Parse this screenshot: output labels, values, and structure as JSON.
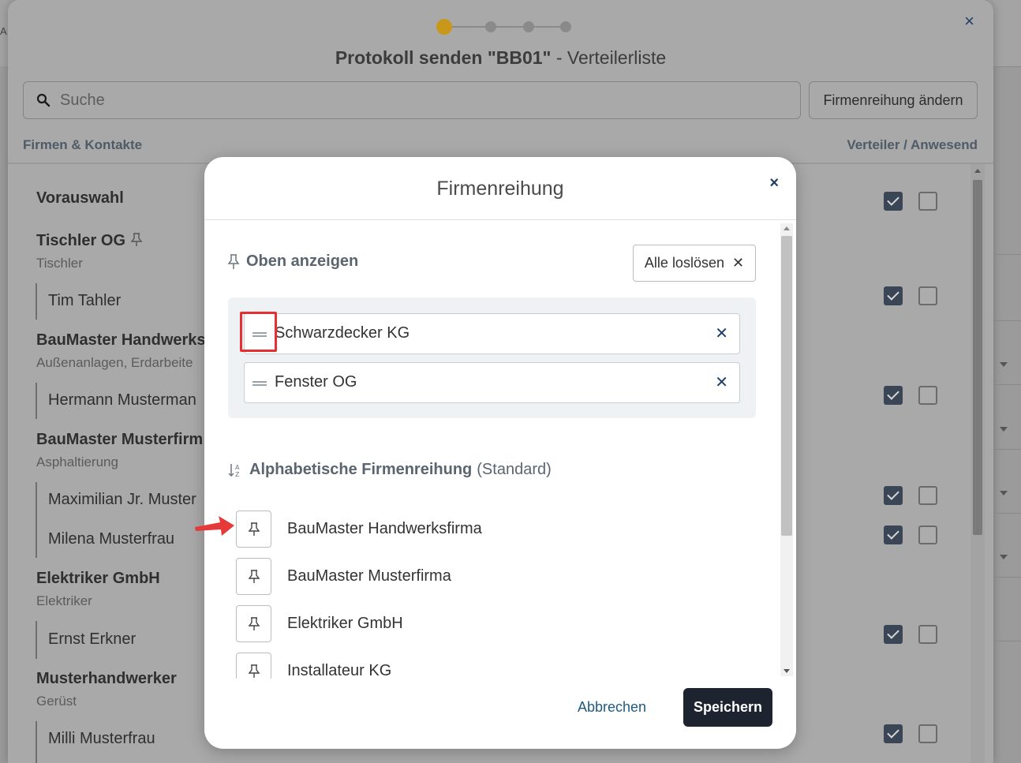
{
  "background": {
    "edge_letter": "A",
    "dialog": {
      "title_bold": "Protokoll senden \"BB01\"",
      "title_rest": " - Verteilerliste",
      "close_icon": "close-icon",
      "stepper_steps": 4,
      "stepper_active_index": 0,
      "search_placeholder": "Suche",
      "order_button_label": "Firmenreihung ändern",
      "column_left": "Firmen & Kontakte",
      "column_right": "Verteiler / Anwesend"
    },
    "list": {
      "vorauswahl": "Vorauswahl",
      "tischler_og": "Tischler OG",
      "tischler": "Tischler",
      "tim_tahler": "Tim Tahler",
      "baumaster_handwerks": "BauMaster Handwerks",
      "aussenanlagen": "Außenanlagen, Erdarbeite",
      "hermann": "Hermann Musterman",
      "baumaster_musterfirm": "BauMaster Musterfirm",
      "asphaltierung": "Asphaltierung",
      "maximilian": "Maximilian Jr. Muster",
      "milena": "Milena Musterfrau",
      "elektriker_gmbh": "Elektriker GmbH",
      "elektriker": "Elektriker",
      "ernst": "Ernst Erkner",
      "musterhandwerker": "Musterhandwerker",
      "geruest": "Gerüst",
      "milli": "Milli Musterfrau"
    }
  },
  "modal": {
    "title": "Firmenreihung",
    "pinned_section_title": "Oben anzeigen",
    "unpin_all_label": "Alle loslösen",
    "pinned": [
      {
        "name": "Schwarzdecker KG"
      },
      {
        "name": "Fenster OG"
      }
    ],
    "alpha_section_title": "Alphabetische Firmenreihung",
    "alpha_section_suffix": "(Standard)",
    "companies": [
      {
        "name": "BauMaster Handwerksfirma"
      },
      {
        "name": "BauMaster Musterfirma"
      },
      {
        "name": "Elektriker GmbH"
      },
      {
        "name": "Installateur KG"
      }
    ],
    "cancel_label": "Abbrechen",
    "save_label": "Speichern"
  },
  "colors": {
    "accent_step": "#c9971a",
    "primary_dark": "#1d2430",
    "link_blue": "#1f5a80",
    "highlight_red": "#e63030"
  }
}
